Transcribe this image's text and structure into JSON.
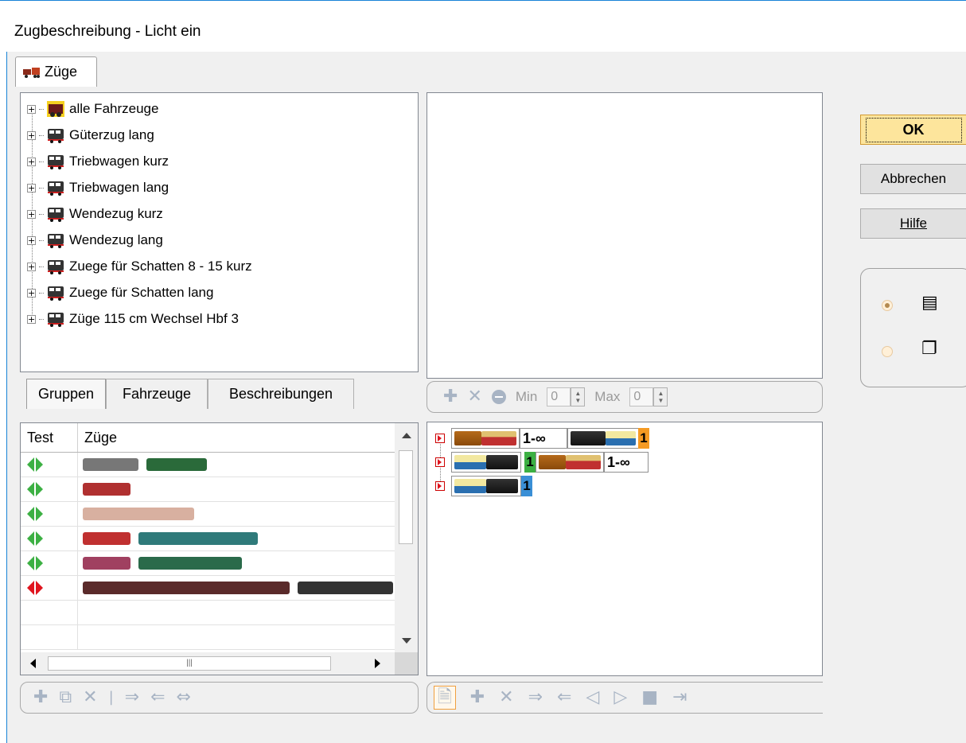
{
  "window": {
    "title": "Zugbeschreibung - Licht ein"
  },
  "top_tab": {
    "label": "Züge"
  },
  "tree": {
    "items": [
      {
        "label": "alle Fahrzeuge"
      },
      {
        "label": "Güterzug lang"
      },
      {
        "label": "Triebwagen kurz"
      },
      {
        "label": "Triebwagen lang"
      },
      {
        "label": "Wendezug kurz"
      },
      {
        "label": "Wendezug lang"
      },
      {
        "label": "Zuege für Schatten 8 - 15 kurz"
      },
      {
        "label": "Zuege für Schatten lang"
      },
      {
        "label": "Züge 115 cm Wechsel Hbf 3"
      }
    ]
  },
  "subtabs": {
    "groups": "Gruppen",
    "vehicles": "Fahrzeuge",
    "descriptions": "Beschreibungen"
  },
  "grid": {
    "col_test": "Test",
    "col_trains": "Züge",
    "rows": [
      {
        "status": "green"
      },
      {
        "status": "green"
      },
      {
        "status": "green"
      },
      {
        "status": "green"
      },
      {
        "status": "green"
      },
      {
        "status": "red"
      }
    ]
  },
  "rule_toolbar": {
    "min_label": "Min",
    "min_value": "0",
    "max_label": "Max",
    "max_value": "0"
  },
  "config": {
    "rows": [
      {
        "count1": "1-∞",
        "count2": "1"
      },
      {
        "count1": "1",
        "count2": "1-∞"
      },
      {
        "count1": "1"
      }
    ]
  },
  "buttons": {
    "ok": "OK",
    "cancel": "Abbrechen",
    "help": "Hilfe"
  },
  "colors": {
    "accent": "#1883d7",
    "ok_button": "#fde59c",
    "green": "#3cb043",
    "red": "#e0141e",
    "count_orange": "#f59a23",
    "count_blue": "#3a8fd6",
    "count_green": "#3cb043"
  }
}
